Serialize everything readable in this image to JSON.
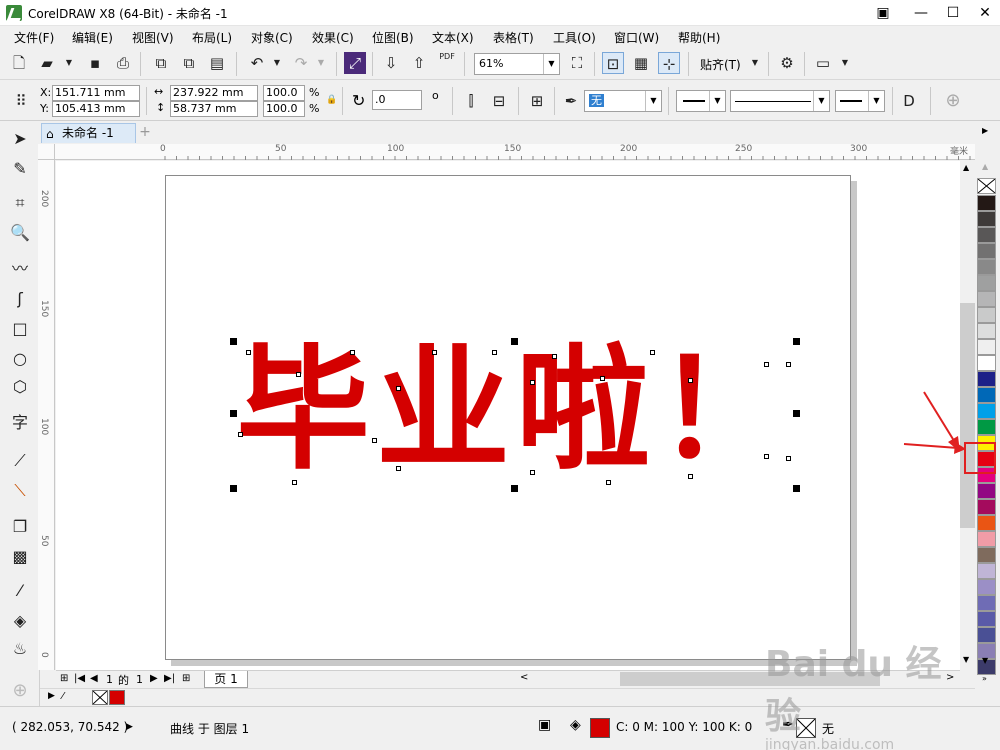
{
  "window": {
    "title": "CorelDRAW X8 (64-Bit) - 未命名 -1",
    "minimize": "—",
    "maximize": "☐",
    "close": "✕"
  },
  "menu": [
    "文件(F)",
    "编辑(E)",
    "视图(V)",
    "布局(L)",
    "对象(C)",
    "效果(C)",
    "位图(B)",
    "文本(X)",
    "表格(T)",
    "工具(O)",
    "窗口(W)",
    "帮助(H)"
  ],
  "toolbar": {
    "zoom": "61%",
    "snap_label": "贴齐(T)",
    "pdf_label": "PDF"
  },
  "properties": {
    "x_label": "X:",
    "x": "151.711 mm",
    "y_label": "Y:",
    "y": "105.413 mm",
    "width": "237.922 mm",
    "height": "58.737 mm",
    "scale_w": "100.0",
    "scale_h": "100.0",
    "pct": "%",
    "rotation": ".0",
    "degree": "o",
    "outline_width": "无"
  },
  "document": {
    "tab": "未命名 -1",
    "canvas_text": "毕业啦！",
    "text_color": "#d40000"
  },
  "ruler": {
    "h_ticks": [
      "0",
      "50",
      "100",
      "150",
      "200",
      "250",
      "300"
    ],
    "v_ticks": [
      "200",
      "150",
      "100",
      "50",
      "0"
    ],
    "unit": "毫米"
  },
  "pagenav": {
    "current": "1",
    "of": "的",
    "total": "1",
    "page_tab": "页 1"
  },
  "palette": [
    "#231815",
    "#3e3a39",
    "#595757",
    "#727171",
    "#898989",
    "#9fa0a0",
    "#b5b5b6",
    "#c9caca",
    "#dcdddd",
    "#efefef",
    "#ffffff",
    "#1d2088",
    "#0068b7",
    "#00a0e9",
    "#009944",
    "#fff100",
    "#e60012",
    "#e4007f",
    "#920783",
    "#a40b5d",
    "#ea5514",
    "#f19ca7",
    "#7f6b5d",
    "#c0b5d6",
    "#9b8fc6",
    "#6f6cb5",
    "#5a5aa8",
    "#4a5095",
    "#8a7fb4",
    "#3c3b6a"
  ],
  "status": {
    "coords": "( 282.053, 70.542 )",
    "object_info": "曲线 于 图层 1",
    "fill_info": "C: 0 M: 100 Y: 100 K: 0",
    "outline_info": "无"
  },
  "watermark": "Bai du 经验",
  "watermark_url": "jingyan.baidu.com"
}
